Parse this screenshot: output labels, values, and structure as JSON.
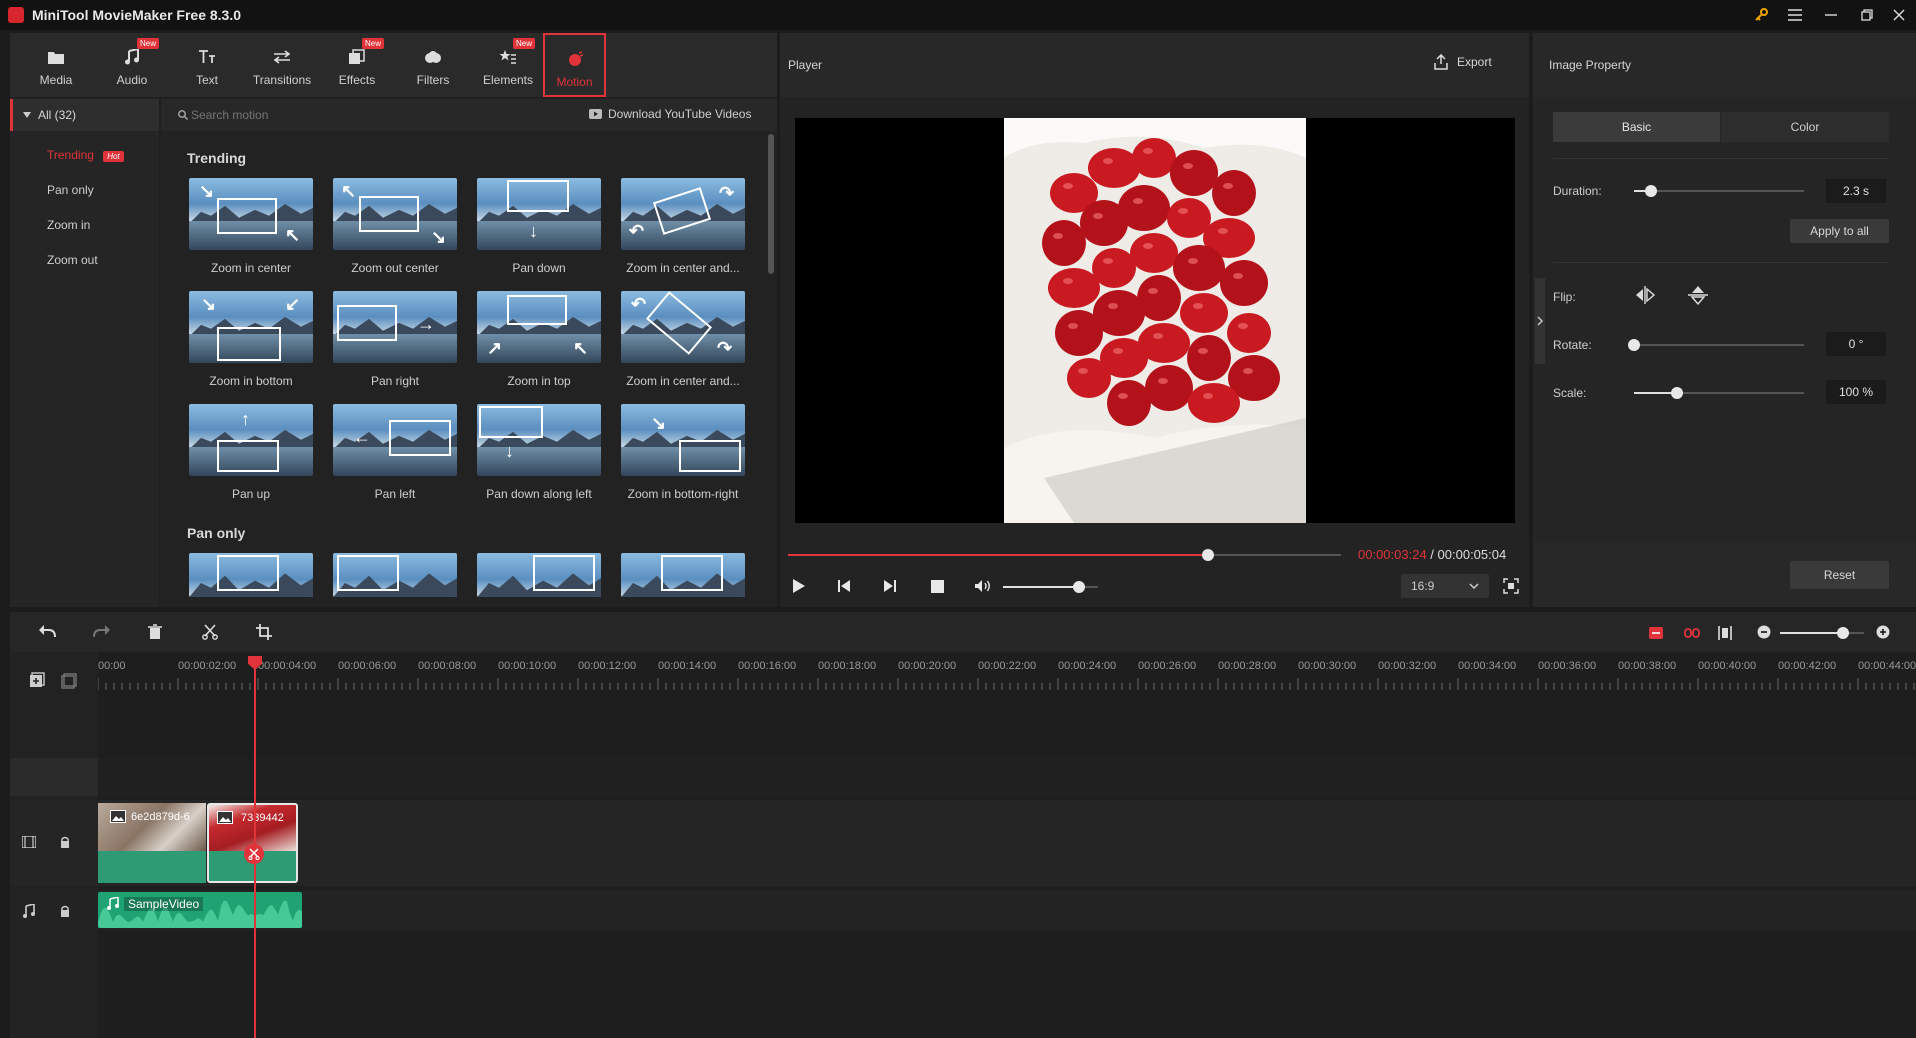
{
  "app": {
    "title": "MiniTool MovieMaker Free 8.3.0"
  },
  "colors": {
    "accent": "#e0333a",
    "panel": "#252525",
    "timeline_clip": "#2fa37a",
    "audio_clip": "#1fa372"
  },
  "toolbar": {
    "items": [
      {
        "label": "Media",
        "icon": "media-icon",
        "new": false
      },
      {
        "label": "Audio",
        "icon": "music-note-icon",
        "new": true
      },
      {
        "label": "Text",
        "icon": "text-icon",
        "new": false
      },
      {
        "label": "Transitions",
        "icon": "transitions-icon",
        "new": false
      },
      {
        "label": "Effects",
        "icon": "effects-icon",
        "new": true
      },
      {
        "label": "Filters",
        "icon": "filters-icon",
        "new": false
      },
      {
        "label": "Elements",
        "icon": "elements-icon",
        "new": true
      },
      {
        "label": "Motion",
        "icon": "motion-icon",
        "new": false,
        "active": true
      }
    ],
    "new_badge": "New"
  },
  "categories": {
    "all": "All (32)",
    "items": [
      "Trending",
      "Pan only",
      "Zoom in",
      "Zoom out"
    ],
    "hot_badge": "Hot"
  },
  "search": {
    "placeholder": "Search motion",
    "download_link": "Download YouTube Videos"
  },
  "sections": {
    "trending": "Trending",
    "pan_only": "Pan only"
  },
  "motions": [
    "Zoom in center",
    "Zoom out center",
    "Pan down",
    "Zoom in center and...",
    "Zoom in bottom",
    "Pan right",
    "Zoom in top",
    "Zoom in center and...",
    "Pan up",
    "Pan left",
    "Pan down along left",
    "Zoom in bottom-right"
  ],
  "player": {
    "title": "Player",
    "export": "Export",
    "current_time": "00:00:03:24",
    "separator": " / ",
    "total_time": "00:00:05:04",
    "progress": 0.76,
    "volume": 0.8,
    "aspect": "16:9"
  },
  "property": {
    "title": "Image Property",
    "tabs": [
      "Basic",
      "Color"
    ],
    "duration_label": "Duration:",
    "duration_value": "2.3 s",
    "duration_level": 0.1,
    "apply_all": "Apply to all",
    "flip_label": "Flip:",
    "rotate_label": "Rotate:",
    "rotate_value": "0 °",
    "rotate_level": 0.0,
    "scale_label": "Scale:",
    "scale_value": "100 %",
    "scale_level": 0.25,
    "reset": "Reset"
  },
  "timeline": {
    "ruler": [
      "00:00",
      "00:00:02:00",
      "00:00:04:00",
      "00:00:06:00",
      "00:00:08:00",
      "00:00:10:00",
      "00:00:12:00",
      "00:00:14:00",
      "00:00:16:00",
      "00:00:18:00",
      "00:00:20:00",
      "00:00:22:00",
      "00:00:24:00",
      "00:00:26:00",
      "00:00:28:00",
      "00:00:30:00",
      "00:00:32:00",
      "00:00:34:00",
      "00:00:36:00",
      "00:00:38:00",
      "00:00:40:00",
      "00:00:42:00",
      "00:00:44:00"
    ],
    "clips": [
      "6e2d879d-6",
      "7339442"
    ],
    "audio_clip": "SampleVideo",
    "zoom_level": 0.75
  }
}
